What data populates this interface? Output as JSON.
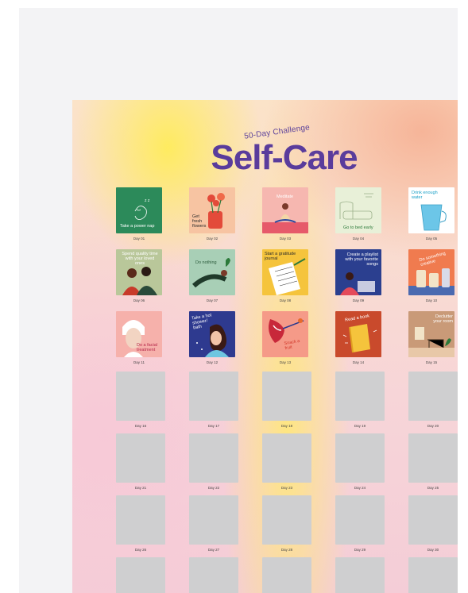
{
  "poster": {
    "subtitle": "50-Day Challenge",
    "title": "Self-Care"
  },
  "tiles": [
    {
      "text": "Take a power nap",
      "day": "Day 01",
      "bg": "#2c8a5a",
      "fg": "#ffffff"
    },
    {
      "text": "Get fresh flowers",
      "day": "Day 02",
      "bg": "#f7c4a2",
      "fg": "#2a2a2a"
    },
    {
      "text": "Meditate",
      "day": "Day 03",
      "bg": "#f6b7b0",
      "fg": "#ffffff"
    },
    {
      "text": "Go to bed early",
      "day": "Day 04",
      "bg": "#e8f0d8",
      "fg": "#2c7a3a"
    },
    {
      "text": "Drink enough water",
      "day": "Day 05",
      "bg": "#ffffff",
      "fg": "#1aa0c7"
    },
    {
      "text": "Spend quality time with your loved ones",
      "day": "Day 06",
      "bg": "#b9c79a",
      "fg": "#ffffff"
    },
    {
      "text": "Do nothing",
      "day": "Day 07",
      "bg": "#a8cfb6",
      "fg": "#2a5a3a"
    },
    {
      "text": "Start a gratitude journal",
      "day": "Day 08",
      "bg": "#f5c43c",
      "fg": "#2a2a2a"
    },
    {
      "text": "Create a playlist with your favorite songs",
      "day": "Day 09",
      "bg": "#2b3f8f",
      "fg": "#ffffff"
    },
    {
      "text": "Do something creative",
      "day": "Day 10",
      "bg": "#f07b4f",
      "fg": "#ffffff"
    },
    {
      "text": "Do a facial treatment",
      "day": "Day 11",
      "bg": "#f6b1ab",
      "fg": "#b5284a"
    },
    {
      "text": "Take a hot shower/ bath",
      "day": "Day 12",
      "bg": "#2e3a8f",
      "fg": "#ffffff"
    },
    {
      "text": "Snack a fruit",
      "day": "Day 13",
      "bg": "#f59a88",
      "fg": "#d23a2c"
    },
    {
      "text": "Read a book",
      "day": "Day 14",
      "bg": "#c94a2c",
      "fg": "#ffffff"
    },
    {
      "text": "Declutter your room",
      "day": "Day 15",
      "bg": "#c99a78",
      "fg": "#ffffff"
    }
  ],
  "empty_days": [
    "Day 16",
    "Day 17",
    "Day 18",
    "Day 19",
    "Day 20",
    "Day 21",
    "Day 22",
    "Day 23",
    "Day 24",
    "Day 25",
    "Day 26",
    "Day 27",
    "Day 28",
    "Day 29",
    "Day 30"
  ]
}
